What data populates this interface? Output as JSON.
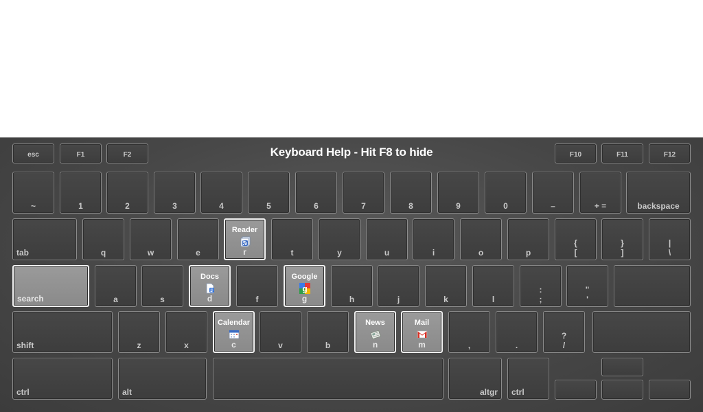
{
  "title": "Keyboard Help - Hit F8 to hide",
  "keys": {
    "esc": "esc",
    "f1": "F1",
    "f2": "F2",
    "f10": "F10",
    "f11": "F11",
    "f12": "F12",
    "tilde": "~",
    "k1": "1",
    "k2": "2",
    "k3": "3",
    "k4": "4",
    "k5": "5",
    "k6": "6",
    "k7": "7",
    "k8": "8",
    "k9": "9",
    "k0": "0",
    "minus": "–",
    "plus": "+ =",
    "backspace": "backspace",
    "tab": "tab",
    "q": "q",
    "w": "w",
    "e": "e",
    "r": "r",
    "t": "t",
    "y": "y",
    "u": "u",
    "i": "i",
    "o": "o",
    "p": "p",
    "brace_top": "{",
    "brace_bottom": "[",
    "rbrace_top": "}",
    "rbrace_bottom": "]",
    "pipe_top": "|",
    "pipe_bottom": "\\",
    "search": "search",
    "a": "a",
    "s": "s",
    "d": "d",
    "f": "f",
    "g": "g",
    "h": "h",
    "j": "j",
    "k": "k",
    "l": "l",
    "colon_top": ":",
    "colon_bottom": ";",
    "quote_top": "\"",
    "quote_bottom": "'",
    "shift": "shift",
    "z": "z",
    "x": "x",
    "c": "c",
    "v": "v",
    "b": "b",
    "n": "n",
    "m": "m",
    "comma": ",",
    "period": ".",
    "question_top": "?",
    "question_bottom": "/",
    "ctrl": "ctrl",
    "alt": "alt",
    "altgr": "altgr",
    "ctrl_right": "ctrl"
  },
  "shortcuts": {
    "reader": "Reader",
    "docs": "Docs",
    "google": "Google",
    "calendar": "Calendar",
    "news": "News",
    "mail": "Mail"
  },
  "colors": {
    "background": "#474747",
    "key_border": "#8c8c8c",
    "highlight": "#9a9a9a"
  }
}
